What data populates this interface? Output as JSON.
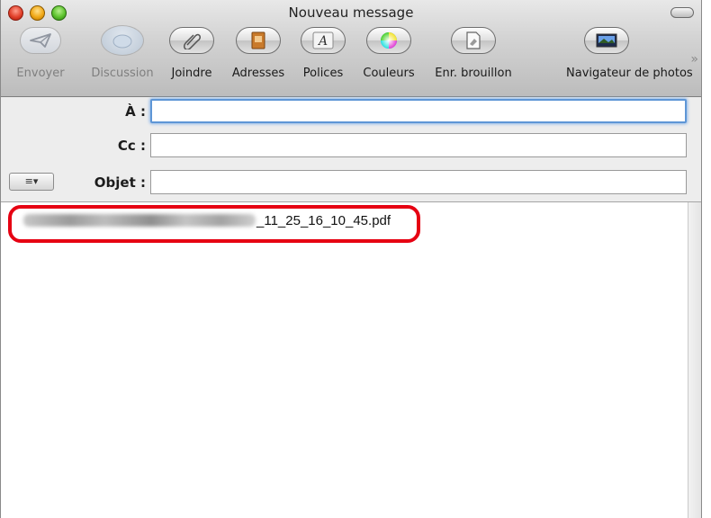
{
  "window": {
    "title": "Nouveau message"
  },
  "toolbar": {
    "items": [
      {
        "label": "Envoyer",
        "icon": "send-icon",
        "enabled": false
      },
      {
        "label": "Discussion",
        "icon": "chat-icon",
        "enabled": false
      },
      {
        "label": "Joindre",
        "icon": "paperclip-icon",
        "enabled": true
      },
      {
        "label": "Adresses",
        "icon": "address-book-icon",
        "enabled": true
      },
      {
        "label": "Polices",
        "icon": "fonts-icon",
        "enabled": true
      },
      {
        "label": "Couleurs",
        "icon": "color-wheel-icon",
        "enabled": true
      },
      {
        "label": "Enr. brouillon",
        "icon": "save-draft-icon",
        "enabled": true
      },
      {
        "label": "Navigateur de photos",
        "icon": "photo-browser-icon",
        "enabled": true
      }
    ],
    "overflow_glyph": "»"
  },
  "headers": {
    "to_label": "À :",
    "cc_label": "Cc :",
    "subject_label": "Objet :",
    "to_value": "",
    "cc_value": "",
    "subject_value": "",
    "options_menu_glyph": "≡▾"
  },
  "body": {
    "attachment_name_visible": "_11_25_16_10_45.pdf"
  },
  "colors": {
    "highlight": "#e60012",
    "focus": "#5e96d6"
  }
}
